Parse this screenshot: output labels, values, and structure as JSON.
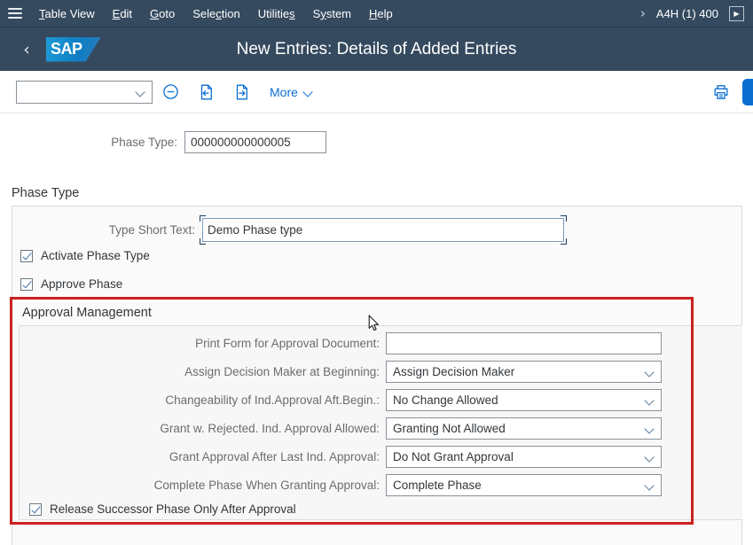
{
  "menubar": {
    "hamburger_icon": "hamburger-icon",
    "items": [
      {
        "label": "Table View",
        "accesskey": "T"
      },
      {
        "label": "Edit",
        "accesskey": "E"
      },
      {
        "label": "Goto",
        "accesskey": "G"
      },
      {
        "label": "Selection",
        "accesskey": "c"
      },
      {
        "label": "Utilities",
        "accesskey": "s"
      },
      {
        "label": "System",
        "accesskey": "y"
      },
      {
        "label": "Help",
        "accesskey": "H"
      }
    ],
    "overflow_chevron": "›",
    "system_id": "A4H (1) 400",
    "overflow_button_icon": "▶"
  },
  "shellbar": {
    "back_icon": "‹",
    "logo_text": "SAP",
    "title": "New Entries: Details of Added Entries"
  },
  "toolbar": {
    "select_value": "",
    "icons": [
      {
        "name": "delete-row-icon"
      },
      {
        "name": "previous-entry-icon"
      },
      {
        "name": "next-entry-icon"
      }
    ],
    "more_label": "More",
    "print_icon": "print-icon"
  },
  "form": {
    "phase_type_label": "Phase Type:",
    "phase_type_value": "000000000000005",
    "section_title": "Phase Type",
    "short_text_label": "Type Short Text:",
    "short_text_value": "Demo Phase type",
    "checkbox_activate": {
      "label": "Activate Phase Type",
      "checked": true
    },
    "checkbox_approve": {
      "label": "Approve Phase",
      "checked": true
    },
    "approval_group_title": "Approval Management",
    "rows": [
      {
        "label": "Print Form for Approval Document:",
        "value": "",
        "type": "input"
      },
      {
        "label": "Assign Decision Maker at Beginning:",
        "value": "Assign Decision Maker",
        "type": "select"
      },
      {
        "label": "Changeability of Ind.Approval Aft.Begin.:",
        "value": "No Change Allowed",
        "type": "select"
      },
      {
        "label": "Grant w. Rejected. Ind. Approval Allowed:",
        "value": "Granting Not Allowed",
        "type": "select"
      },
      {
        "label": "Grant Approval After Last Ind. Approval:",
        "value": "Do Not Grant Approval",
        "type": "select"
      },
      {
        "label": "Complete Phase When Granting Approval:",
        "value": "Complete Phase",
        "type": "select"
      }
    ],
    "checkbox_release": {
      "label": "Release Successor Phase Only After Approval",
      "checked": true
    }
  },
  "annotation": {
    "color": "#cc2020"
  },
  "colors": {
    "shell_bg": "#354a5f",
    "accent": "#0a6ed1",
    "label_text": "#6a6d70",
    "value_text": "#32363a",
    "annotation_red": "#cc2020"
  }
}
